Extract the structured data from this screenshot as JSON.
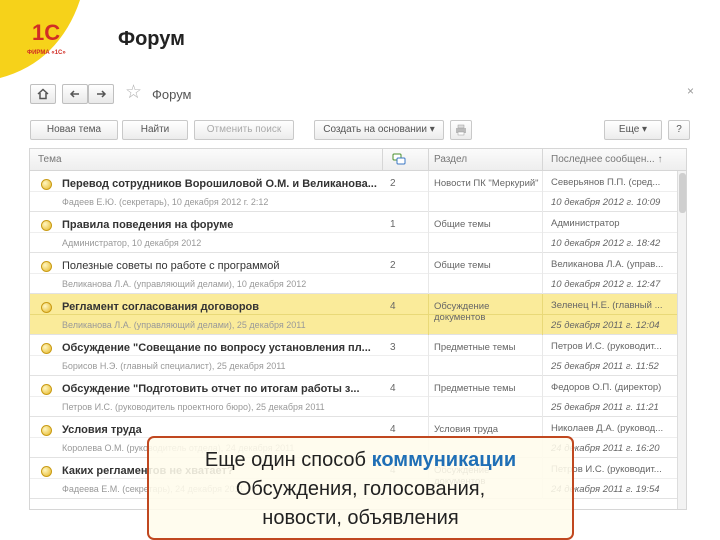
{
  "slide": {
    "title": "Форум",
    "logo_text": "ФИРМА «1С»",
    "logo_mark": "1С"
  },
  "window": {
    "title": "Форум",
    "home_icon": "home-icon",
    "back_icon": "arrow-left-icon",
    "forward_icon": "arrow-right-icon",
    "favorite_icon": "star-icon",
    "close_glyph": "×"
  },
  "toolbar": {
    "new_topic": "Новая тема",
    "find": "Найти",
    "cancel_search": "Отменить поиск",
    "create_based_on": "Создать на основании",
    "more": "Еще",
    "help": "?"
  },
  "grid": {
    "headers": {
      "topic": "Тема",
      "section": "Раздел",
      "last_message": "Последнее сообщен... ↑"
    },
    "rows": [
      {
        "topic": "Перевод сотрудников Ворошиловой О.М. и Великанова...",
        "author": "Фадеев Е.Ю. (секретарь), 10 декабря 2012 г. 2:12",
        "count": "2",
        "section": "Новости ПК \"Меркурий\"",
        "last_author": "Северьянов П.П. (сред...",
        "last_date": "10 декабря 2012 г. 10:09",
        "selected": false,
        "bold": true
      },
      {
        "topic": "Правила поведения на форуме",
        "author": "Администратор, 10 декабря 2012",
        "count": "1",
        "section": "Общие темы",
        "last_author": "Администратор",
        "last_date": "10 декабря 2012 г. 18:42",
        "selected": false,
        "bold": true
      },
      {
        "topic": "Полезные советы по работе с программой",
        "author": "Великанова Л.А. (управляющий делами), 10 декабря 2012",
        "count": "2",
        "section": "Общие темы",
        "last_author": "Великанова Л.А. (управ...",
        "last_date": "10 декабря 2012 г. 12:47",
        "selected": false,
        "bold": false
      },
      {
        "topic": "Регламент согласования договоров",
        "author": "Великанова Л.А. (управляющий делами), 25 декабря 2011",
        "count": "4",
        "section": "Обсуждение документов",
        "last_author": "Зеленец Н.Е. (главный ...",
        "last_date": "25 декабря 2011 г. 12:04",
        "selected": true,
        "bold": true
      },
      {
        "topic": "Обсуждение \"Совещание по вопросу установления пл...",
        "author": "Борисов Н.Э. (главный специалист), 25 декабря 2011",
        "count": "3",
        "section": "Предметные темы",
        "last_author": "Петров И.С. (руководит...",
        "last_date": "25 декабря 2011 г. 11:52",
        "selected": false,
        "bold": true
      },
      {
        "topic": "Обсуждение \"Подготовить отчет по итогам работы з...",
        "author": "Петров И.С. (руководитель проектного бюро), 25 декабря 2011",
        "count": "4",
        "section": "Предметные темы",
        "last_author": "Федоров О.П. (директор)",
        "last_date": "25 декабря 2011 г. 11:21",
        "selected": false,
        "bold": true
      },
      {
        "topic": "Условия труда",
        "author": "Королева О.М. (руководитель отдела), 24 декабря 2011",
        "count": "4",
        "section": "Условия труда",
        "last_author": "Николаев Д.А. (руковод...",
        "last_date": "24 декабря 2011 г. 16:20",
        "selected": false,
        "bold": true
      },
      {
        "topic": "Каких регламентов не хватает?",
        "author": "Фадеева Е.М. (секретарь), 24 декабря 2011",
        "count": "4",
        "section": "Обсуждение документов",
        "last_author": "Петров И.С. (руководит...",
        "last_date": "24 декабря 2011 г. 19:54",
        "selected": false,
        "bold": true
      }
    ]
  },
  "callout": {
    "line1_prefix": "Еще один способ ",
    "line1_highlight": "коммуникации",
    "line2": "Обсуждения, голосования,",
    "line3": "новости, объявления"
  },
  "colors": {
    "selected_row": "#faeb9a",
    "callout_border": "#c0471f",
    "highlight_text": "#1f6fb6",
    "logo_yellow": "#f6d21a",
    "logo_red": "#d12d25"
  }
}
